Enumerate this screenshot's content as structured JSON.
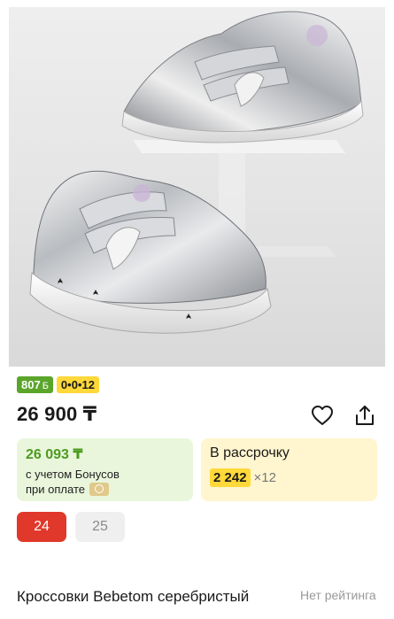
{
  "product": {
    "image_alt": "silver-sneakers-photo",
    "bonus_badge": "807",
    "bonus_badge_icon": "Б",
    "installment_badge": "0•0•12",
    "price": "26 900 ₸",
    "bonus_card": {
      "price": "26 093 ₸",
      "note_line1": "с учетом Бонусов",
      "note_line2": "при оплате"
    },
    "installment_card": {
      "title": "В рассрочку",
      "amount": "2 242",
      "multiplier": "×12"
    },
    "sizes": [
      {
        "label": "24",
        "selected": true
      },
      {
        "label": "25",
        "selected": false
      }
    ],
    "title": "Кроссовки Bebetom серебристый",
    "rating_text": "Нет рейтинга"
  },
  "colors": {
    "bonus_green": "#5aa52a",
    "installment_yellow": "#ffd83a",
    "size_selected_red": "#e0382a"
  },
  "icons": {
    "favorite": "heart-icon",
    "share": "share-icon"
  }
}
